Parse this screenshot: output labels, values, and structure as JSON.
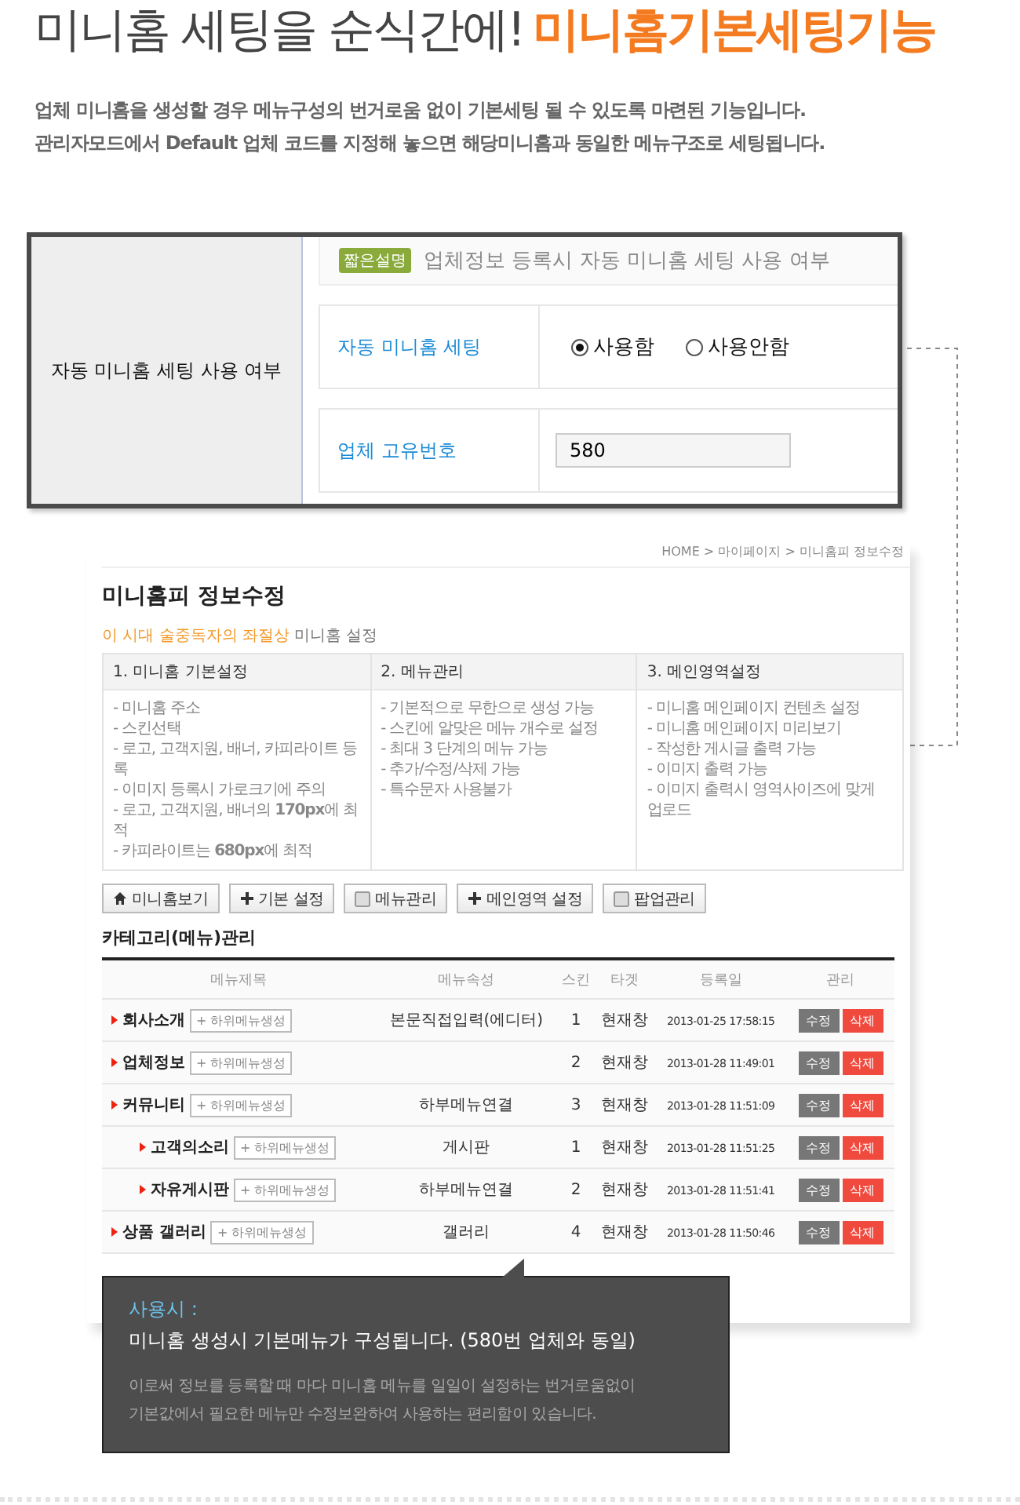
{
  "headline": {
    "plain": "미니홈 세팅을 순식간에!",
    "highlight": "미니홈기본세팅기능"
  },
  "intro_lines": [
    "업체 미니홈을 생성할 경우 메뉴구성의 번거로움 없이 기본세팅 될 수 있도록 마련된 기능입니다.",
    "관리자모드에서 Default 업체 코드를 지정해 놓으면 해당미니홈과 동일한 메뉴구조로 세팅됩니다."
  ],
  "setting_box": {
    "label": "자동 미니홈 세팅 사용 여부",
    "badge": "짧은설명",
    "description": "업체정보 등록시 자동 미니홈 세팅 사용 여부",
    "fields": [
      {
        "kind": "radio",
        "label": "자동 미니홈 세팅",
        "options": [
          {
            "label": "사용함",
            "selected": true
          },
          {
            "label": "사용안함",
            "selected": false
          }
        ]
      },
      {
        "kind": "text",
        "label": "업체 고유번호",
        "value": "580"
      }
    ]
  },
  "screenshot": {
    "breadcrumb": "HOME > 마이페이지 > 미니홈피 정보수정",
    "title": "미니홈피 정보수정",
    "subtitle_highlight": "이 시대 술중독자의 좌절상",
    "subtitle_rest": "미니홈 설정",
    "info_columns": [
      {
        "heading": "1. 미니홈 기본설정",
        "items": [
          "- 미니홈 주소",
          "- 스킨선택",
          "- 로고, 고객지원, 배너, 카피라이트 등록",
          "- 이미지 등록시 가로크기에 주의",
          "- 로고, 고객지원, 배너의 **170px**에 최적",
          "- 카피라이트는 **680px**에 최적"
        ]
      },
      {
        "heading": "2. 메뉴관리",
        "items": [
          "- 기본적으로 무한으로 생성 가능",
          "- 스킨에 알맞은 메뉴 개수로 설정",
          "- 최대 3 단계의 메뉴 가능",
          "- 추가/수정/삭제 가능",
          "- 특수문자 사용불가"
        ]
      },
      {
        "heading": "3. 메인영역설정",
        "items": [
          "- 미니홈 메인페이지 컨텐츠 설정",
          "- 미니홈 메인페이지 미리보기",
          "- 작성한 게시글 출력 가능",
          "- 이미지 출력 가능",
          "- 이미지 출력시 영역사이즈에 맞게 업로드"
        ]
      }
    ],
    "buttons": [
      {
        "kind": "home",
        "label": "미니홈보기"
      },
      {
        "kind": "plus",
        "label": "기본 설정"
      },
      {
        "kind": "page",
        "label": "메뉴관리"
      },
      {
        "kind": "plus",
        "label": "메인영역 설정"
      },
      {
        "kind": "page",
        "label": "팝업관리"
      }
    ],
    "section_title": "카테고리(메뉴)관리",
    "table": {
      "columns": [
        "메뉴제목",
        "메뉴속성",
        "스킨",
        "타겟",
        "등록일",
        "관리"
      ],
      "rows": [
        {
          "title": "회사소개",
          "add": "+ 하위메뉴생성",
          "type": "본문직접입력(에디터)",
          "skin": "1",
          "target": "현재창",
          "date": "2013-01-25 17:58:15",
          "edit": "수정",
          "delete": "삭제"
        },
        {
          "title": "업체정보",
          "add": "+ 하위메뉴생성",
          "type": "",
          "skin": "2",
          "target": "현재창",
          "date": "2013-01-28 11:49:01",
          "edit": "수정",
          "delete": "삭제"
        },
        {
          "title": "커뮤니티",
          "add": "+ 하위메뉴생성",
          "type": "하부메뉴연결",
          "skin": "3",
          "target": "현재창",
          "date": "2013-01-28 11:51:09",
          "edit": "수정",
          "delete": "삭제",
          "children": [
            {
              "title": "고객의소리",
              "add": "+ 하위메뉴생성",
              "type": "게시판",
              "skin": "1",
              "target": "현재창",
              "date": "2013-01-28 11:51:25",
              "edit": "수정",
              "delete": "삭제"
            },
            {
              "title": "자유게시판",
              "add": "+ 하위메뉴생성",
              "type": "하부메뉴연결",
              "skin": "2",
              "target": "현재창",
              "date": "2013-01-28 11:51:41",
              "edit": "수정",
              "delete": "삭제"
            }
          ]
        },
        {
          "title": "상품 갤러리",
          "add": "+ 하위메뉴생성",
          "type": "갤러리",
          "skin": "4",
          "target": "현재창",
          "date": "2013-01-28 11:50:46",
          "edit": "수정",
          "delete": "삭제"
        }
      ]
    }
  },
  "tooltip": {
    "heading": "사용시 :",
    "lead": "미니홈 생성시 기본메뉴가 구성됩니다. (580번 업체와 동일)",
    "body_lines": [
      "이로써 정보를 등록할 때 마다 미니홈 메뉴를 일일이 설정하는 번거로움없이",
      "기본값에서 필요한 메뉴만 수정보완하여 사용하는 편리함이 있습니다."
    ]
  }
}
